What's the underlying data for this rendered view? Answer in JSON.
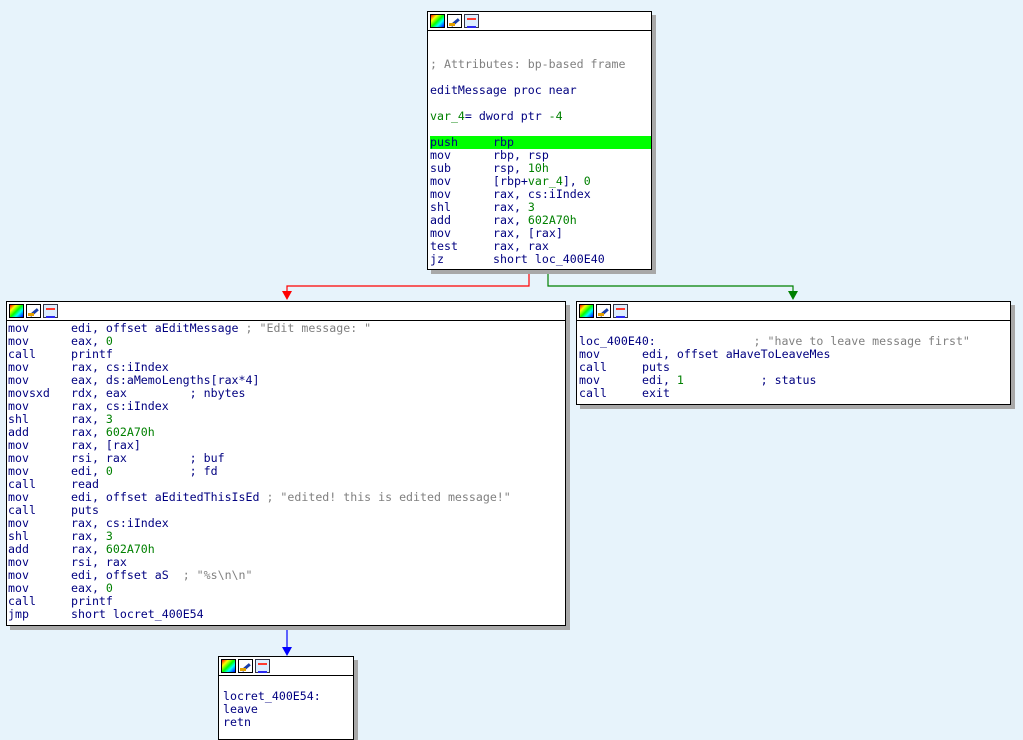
{
  "colors": {
    "background": "#e7f3fb",
    "highlight": "#00ff00",
    "edge_true": "#ff0000",
    "edge_false": "#008000",
    "edge_uncond": "#0000ff"
  },
  "icons": [
    "color-palette-icon",
    "edit-pencil-icon",
    "graph-view-icon"
  ],
  "node_main": {
    "attributes": "; Attributes: bp-based frame",
    "proc": "editMessage proc near",
    "var_decl": "var_4",
    "var_rest": "= dword ptr ",
    "var_val": "-4",
    "lines": [
      {
        "m": "push",
        "o": "rbp"
      },
      {
        "m": "mov",
        "o": "rbp, rsp"
      },
      {
        "m": "sub",
        "o": "rsp, ",
        "n": "10h"
      },
      {
        "m": "mov",
        "o": "[rbp+",
        "v": "var_4",
        "o2": "], ",
        "n2": "0"
      },
      {
        "m": "mov",
        "o": "rax, cs:",
        "s": "iIndex"
      },
      {
        "m": "shl",
        "o": "rax, ",
        "n": "3"
      },
      {
        "m": "add",
        "o": "rax, ",
        "n": "602A70h"
      },
      {
        "m": "mov",
        "o": "rax, [rax]"
      },
      {
        "m": "test",
        "o": "rax, rax"
      },
      {
        "m": "jz",
        "o": "short ",
        "s": "loc_400E40"
      }
    ]
  },
  "node_left": {
    "lines": [
      {
        "m": "mov",
        "o": "edi, offset ",
        "s": "aEditMessage",
        "c": " ; ",
        "str": "\"Edit message: \""
      },
      {
        "m": "mov",
        "o": "eax, ",
        "n": "0"
      },
      {
        "m": "call",
        "s": "printf"
      },
      {
        "m": "mov",
        "o": "rax, cs:",
        "s": "iIndex"
      },
      {
        "m": "mov",
        "o": "eax, ds:",
        "s": "aMemoLengths",
        "o2": "[rax*4]"
      },
      {
        "m": "movsxd",
        "o": "rdx, eax         ",
        "c2": "; nbytes"
      },
      {
        "m": "mov",
        "o": "rax, cs:",
        "s": "iIndex"
      },
      {
        "m": "shl",
        "o": "rax, ",
        "n": "3"
      },
      {
        "m": "add",
        "o": "rax, ",
        "n": "602A70h"
      },
      {
        "m": "mov",
        "o": "rax, [rax]"
      },
      {
        "m": "mov",
        "o": "rsi, rax         ",
        "c2": "; buf"
      },
      {
        "m": "mov",
        "o": "edi, ",
        "n": "0",
        "o2": "           ",
        "c2": "; fd"
      },
      {
        "m": "call",
        "s": "read"
      },
      {
        "m": "mov",
        "o": "edi, offset ",
        "s": "aEditedThisIsEd",
        "c": " ; ",
        "str": "\"edited! this is edited message!\""
      },
      {
        "m": "call",
        "s": "puts"
      },
      {
        "m": "mov",
        "o": "rax, cs:",
        "s": "iIndex"
      },
      {
        "m": "shl",
        "o": "rax, ",
        "n": "3"
      },
      {
        "m": "add",
        "o": "rax, ",
        "n": "602A70h"
      },
      {
        "m": "mov",
        "o": "rsi, rax"
      },
      {
        "m": "mov",
        "o": "edi, offset ",
        "s": "aS",
        "c": "  ; ",
        "str": "\"%s\\n\\n\""
      },
      {
        "m": "mov",
        "o": "eax, ",
        "n": "0"
      },
      {
        "m": "call",
        "s": "printf"
      },
      {
        "m": "jmp",
        "o": "short ",
        "s": "locret_400E54"
      }
    ]
  },
  "node_right": {
    "label": "loc_400E40:",
    "label_comment": "; ",
    "label_str": "\"have to leave message first\"",
    "lines": [
      {
        "m": "mov",
        "o": "edi, offset ",
        "s": "aHaveToLeaveMes"
      },
      {
        "m": "call",
        "s": "puts"
      },
      {
        "m": "mov",
        "o": "edi, ",
        "n": "1",
        "o2": "           ",
        "c2": "; status"
      },
      {
        "m": "call",
        "s": "exit"
      }
    ]
  },
  "node_bottom": {
    "label": "locret_400E54:",
    "lines": [
      {
        "m": "leave"
      },
      {
        "m": "retn"
      }
    ]
  }
}
